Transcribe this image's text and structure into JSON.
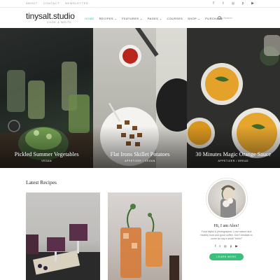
{
  "topbar": {
    "links": [
      "ABOUT",
      "CONTACT",
      "NEWSLETTER"
    ],
    "social_icons": [
      "facebook-icon",
      "twitter-icon",
      "instagram-icon",
      "pinterest-icon",
      "youtube-icon"
    ],
    "social_glyphs": [
      "f",
      "t",
      "◎",
      "p",
      "▶"
    ]
  },
  "header": {
    "site_name": "tinysalt.studio",
    "tagline": "COOK & WRITE"
  },
  "nav": {
    "items": [
      "HOME",
      "RECIPES ⌄",
      "FEATURES ⌄",
      "PAGES ⌄",
      "COURSES",
      "SHOP ⌄",
      "PURCHASE"
    ],
    "active_index": 0,
    "search_placeholder": "Search"
  },
  "hero": {
    "slides": [
      {
        "title": "Pickled Summer Vegetables",
        "category": "VEGAN"
      },
      {
        "title": "Flat Irons Skillet Potatoes",
        "category": "APPETIZER / VEGAN"
      },
      {
        "title": "30 Minutes Magic Orange Sauce",
        "category": "APPETIZER / BREAD"
      }
    ]
  },
  "latest": {
    "heading": "Latest Recipes"
  },
  "sidebar": {
    "greeting": "Hi, I am Alex!",
    "bio": "Food stylist & photographer. Love nature and healthy food and good coffee. Don't hesitate to come for say a small \"hello!\"",
    "socials": [
      "f",
      "t",
      "◎",
      "p",
      "▶"
    ],
    "button_label": "LEARN MORE"
  },
  "colors": {
    "accent": "#3bbf7a"
  }
}
